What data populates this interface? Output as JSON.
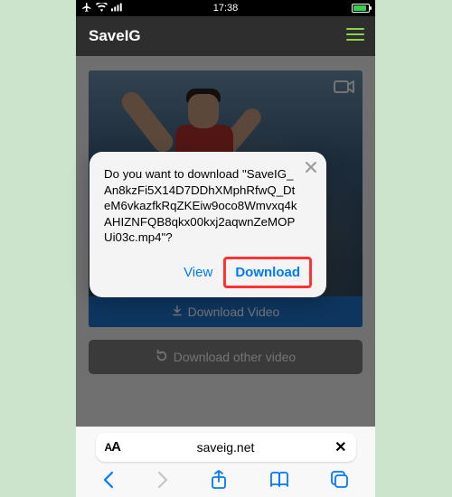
{
  "status": {
    "time": "17:38"
  },
  "header": {
    "title": "SaveIG"
  },
  "video": {
    "download_button": "Download Video"
  },
  "other_button": "Download other video",
  "alert": {
    "message": "Do you want to download \"SaveIG_An8kzFi5X14D7DDhXMphRfwQ_DteM6vkazfkRqZKEiw9oco8Wmvxq4kAHIZNFQB8qkx00kxj2aqwnZeMOPUi03c.mp4\"?",
    "view": "View",
    "download": "Download"
  },
  "browser": {
    "url": "saveig.net"
  }
}
